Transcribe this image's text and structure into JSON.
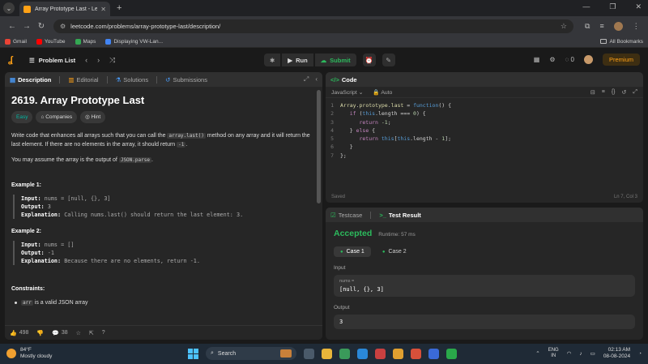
{
  "browser": {
    "tab_title": "Array Prototype Last - LeetCode",
    "url": "leetcode.com/problems/array-prototype-last/description/",
    "bookmarks": [
      "Gmail",
      "YouTube",
      "Maps",
      "Displaying VW-Lan..."
    ],
    "all_bookmarks": "All Bookmarks"
  },
  "header": {
    "problem_list": "Problem List",
    "run": "Run",
    "submit": "Submit",
    "streak": "0",
    "premium": "Premium"
  },
  "desc_tabs": [
    "Description",
    "Editorial",
    "Solutions",
    "Submissions"
  ],
  "problem": {
    "title": "2619. Array Prototype Last",
    "difficulty": "Easy",
    "companies": "Companies",
    "hint": "Hint",
    "p1_a": "Write code that enhances all arrays such that you can call the ",
    "p1_code": "array.last()",
    "p1_b": " method on any array and it will return the last element. If there are no elements in the array, it should return ",
    "p1_code2": "-1",
    "p1_c": ".",
    "p2_a": "You may assume the array is the output of ",
    "p2_code": "JSON.parse",
    "p2_b": ".",
    "ex1_title": "Example 1:",
    "ex1_input_label": "Input:",
    "ex1_input": "nums = [null, {}, 3]",
    "ex1_output_label": "Output:",
    "ex1_output": "3",
    "ex1_expl_label": "Explanation:",
    "ex1_expl": "Calling nums.last() should return the last element: 3.",
    "ex2_title": "Example 2:",
    "ex2_input_label": "Input:",
    "ex2_input": "nums = []",
    "ex2_output_label": "Output:",
    "ex2_output": "-1",
    "ex2_expl_label": "Explanation:",
    "ex2_expl": "Because there are no elements, return -1.",
    "constraints_title": "Constraints:",
    "constraint1_code": "arr",
    "constraint1_text": " is a valid JSON array"
  },
  "desc_footer": {
    "likes": "498",
    "comments": "38"
  },
  "code_panel": {
    "title": "Code",
    "language": "JavaScript",
    "mode": "Auto",
    "saved": "Saved",
    "cursor": "Ln 7, Col 3"
  },
  "test_panel": {
    "tab_testcase": "Testcase",
    "tab_result": "Test Result",
    "status": "Accepted",
    "runtime": "Runtime: 57 ms",
    "case1": "Case 1",
    "case2": "Case 2",
    "input_label": "Input",
    "var_name": "nums =",
    "input_value": "[null, {}, 3]",
    "output_label": "Output",
    "output_value": "3"
  },
  "taskbar": {
    "temp": "84°F",
    "weather": "Mostly cloudy",
    "search": "Search",
    "lang1": "ENG",
    "lang2": "IN",
    "time": "02:13 AM",
    "date": "08-08-2024"
  },
  "colors": {
    "accent": "#ffa116",
    "success": "#2cbb5d",
    "easy": "#00b8a3"
  }
}
